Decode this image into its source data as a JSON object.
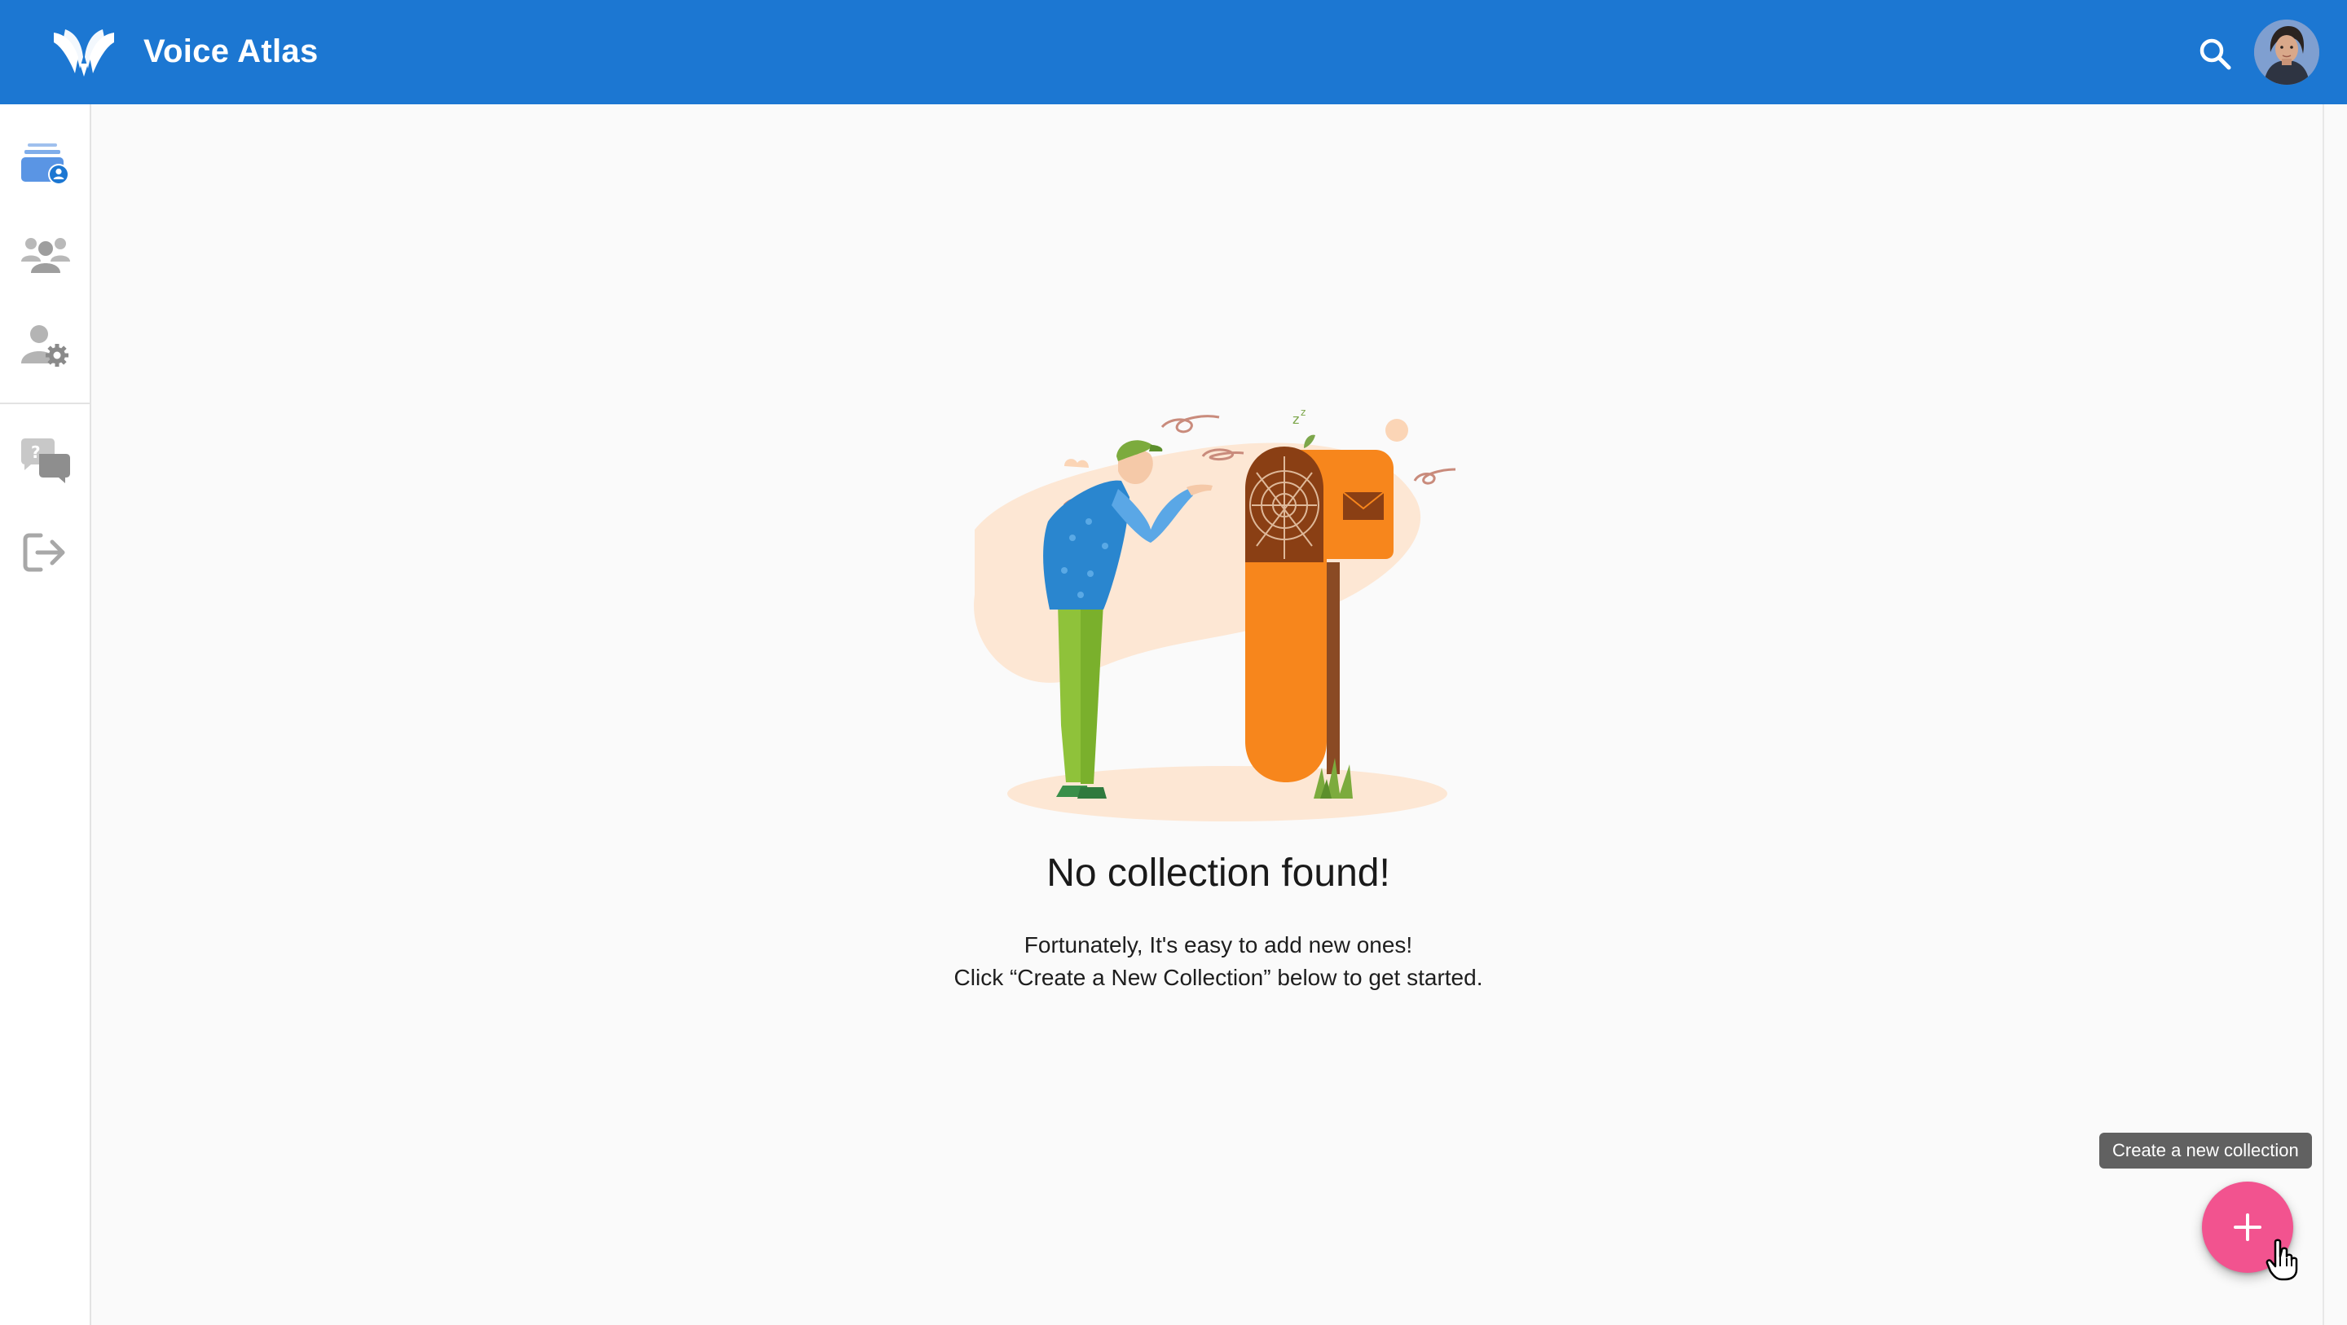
{
  "app": {
    "title": "Voice Atlas",
    "brand_color": "#1c77d2"
  },
  "header": {
    "icons": {
      "logo": "voice-atlas-logo",
      "search": "search-icon",
      "avatar": "user-avatar"
    }
  },
  "sidebar": {
    "items": [
      {
        "icon": "collections-icon",
        "active": true
      },
      {
        "icon": "users-group-icon",
        "active": false
      },
      {
        "icon": "user-settings-icon",
        "active": false
      },
      {
        "icon": "help-chat-icon",
        "active": false
      },
      {
        "icon": "logout-icon",
        "active": false
      }
    ]
  },
  "empty_state": {
    "title": "No collection found!",
    "line1": "Fortunately, It's easy to add new ones!",
    "line2": "Click “Create a New Collection” below to get started."
  },
  "fab": {
    "tooltip": "Create a new collection",
    "icon": "plus-icon",
    "color": "#f2538f"
  }
}
